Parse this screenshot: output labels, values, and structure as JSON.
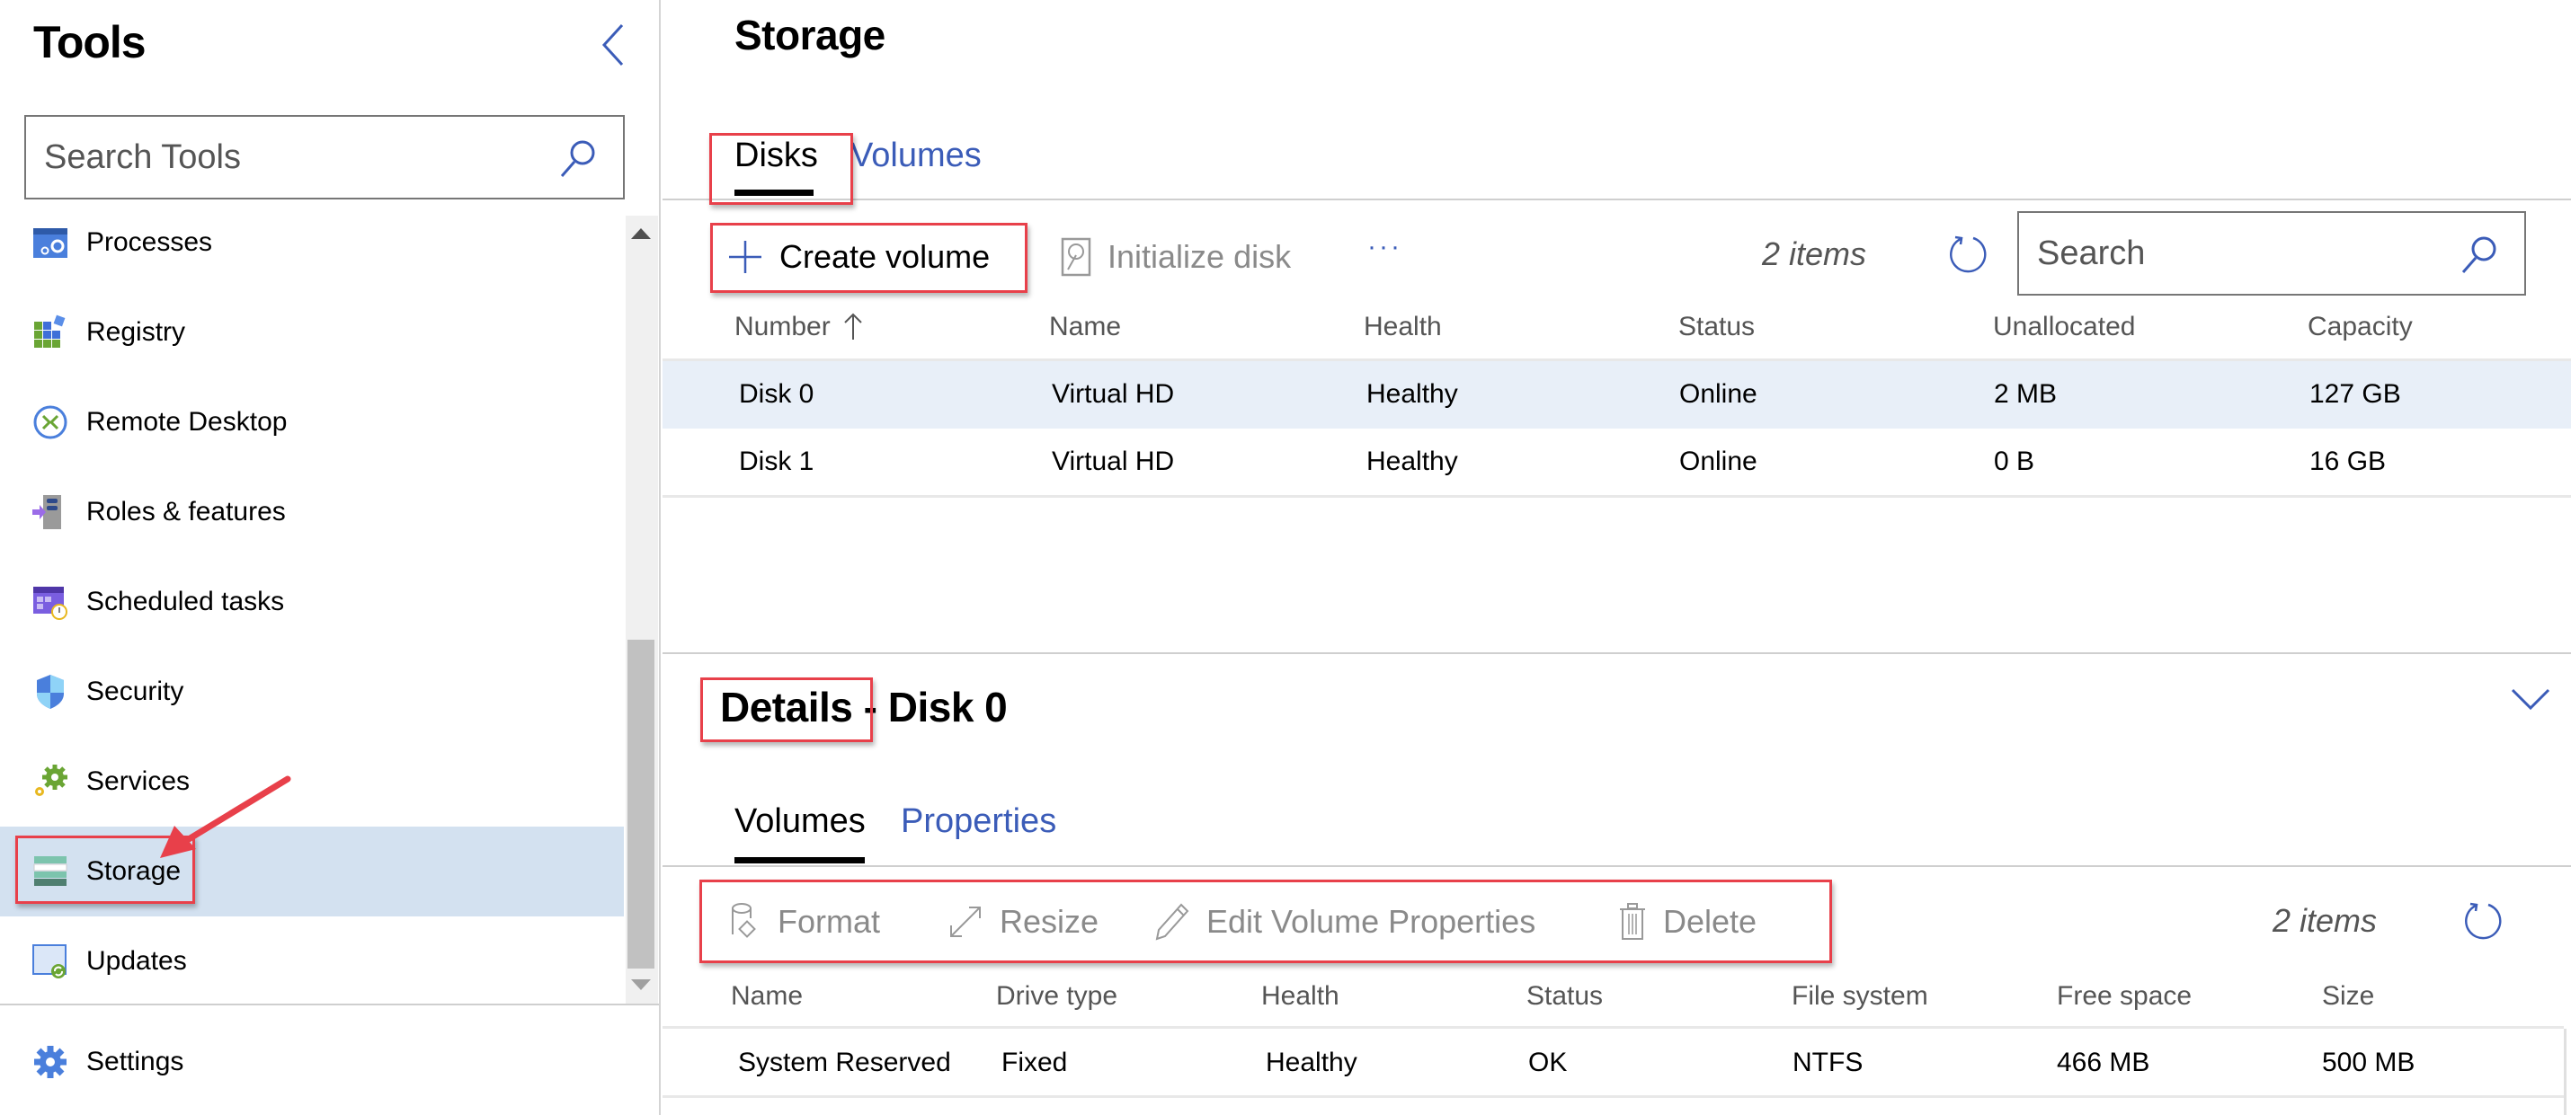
{
  "sidebar": {
    "title": "Tools",
    "collapse_icon": "chevron-left-icon",
    "search": {
      "placeholder": "Search Tools",
      "value": "",
      "icon": "search-icon"
    },
    "items": [
      {
        "label": "Processes",
        "icon": "processes-icon",
        "selected": false
      },
      {
        "label": "Registry",
        "icon": "registry-icon",
        "selected": false
      },
      {
        "label": "Remote Desktop",
        "icon": "remote-desktop-icon",
        "selected": false
      },
      {
        "label": "Roles & features",
        "icon": "roles-features-icon",
        "selected": false
      },
      {
        "label": "Scheduled tasks",
        "icon": "scheduled-tasks-icon",
        "selected": false
      },
      {
        "label": "Security",
        "icon": "security-shield-icon",
        "selected": false
      },
      {
        "label": "Services",
        "icon": "services-gears-icon",
        "selected": false
      },
      {
        "label": "Storage",
        "icon": "storage-icon",
        "selected": true
      },
      {
        "label": "Updates",
        "icon": "updates-icon",
        "selected": false
      }
    ],
    "footer": {
      "label": "Settings",
      "icon": "settings-gear-icon"
    }
  },
  "main": {
    "title": "Storage",
    "tabs": [
      {
        "label": "Disks",
        "active": true
      },
      {
        "label": "Volumes",
        "active": false
      }
    ],
    "toolbar": {
      "create_volume": "Create volume",
      "initialize_disk": "Initialize disk",
      "more": "···",
      "item_count": "2 items",
      "search_placeholder": "Search"
    },
    "disks_table": {
      "sort_column": "Number",
      "sort_direction": "ascending",
      "columns": [
        "Number",
        "Name",
        "Health",
        "Status",
        "Unallocated",
        "Capacity"
      ],
      "rows": [
        {
          "number": "Disk 0",
          "name": "Virtual HD",
          "health": "Healthy",
          "status": "Online",
          "unallocated": "2 MB",
          "capacity": "127 GB",
          "selected": true
        },
        {
          "number": "Disk 1",
          "name": "Virtual HD",
          "health": "Healthy",
          "status": "Online",
          "unallocated": "0 B",
          "capacity": "16 GB",
          "selected": false
        }
      ]
    }
  },
  "details": {
    "title_prefix": "Details",
    "title_suffix": " - Disk 0",
    "tabs": [
      {
        "label": "Volumes",
        "active": true
      },
      {
        "label": "Properties",
        "active": false
      }
    ],
    "toolbar": {
      "format": "Format",
      "resize": "Resize",
      "edit_volume_properties": "Edit Volume Properties",
      "delete": "Delete",
      "item_count": "2 items"
    },
    "volumes_table": {
      "columns": [
        "Name",
        "Drive type",
        "Health",
        "Status",
        "File system",
        "Free space",
        "Size"
      ],
      "rows": [
        {
          "name": "System Reserved",
          "drive_type": "Fixed",
          "health": "Healthy",
          "status": "OK",
          "file_system": "NTFS",
          "free_space": "466 MB",
          "size": "500 MB"
        }
      ]
    }
  },
  "colors": {
    "accent": "#3b5cb8",
    "selection": "#d3e1f0",
    "row_selected": "#e8eff8",
    "annotation_red": "#e8404a",
    "disabled_text": "#8a8a8a"
  }
}
